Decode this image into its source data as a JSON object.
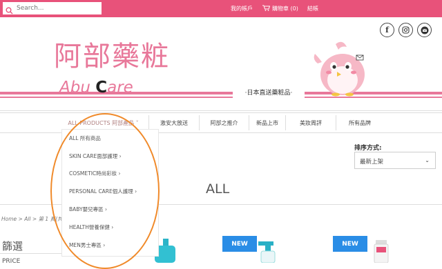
{
  "topbar": {
    "search_placeholder": "Search...",
    "account": "我的帳戶",
    "cart": "購物車 (0)",
    "checkout": "結帳"
  },
  "header": {
    "logo_cn": "阿部藥粧",
    "logo_en_pre": "Abu ",
    "logo_en_c": "C",
    "logo_en_post": "are",
    "tagline": "‧日本直送藥粧品‧"
  },
  "nav": {
    "items": [
      {
        "label": "ALL PRODUCTS 阿部產品 ˅"
      },
      {
        "label": "激安大放送"
      },
      {
        "label": "阿部之推介"
      },
      {
        "label": "新品上市"
      },
      {
        "label": "美妝周評"
      },
      {
        "label": "所有品牌"
      }
    ]
  },
  "dropdown": {
    "items": [
      {
        "label": "ALL 所有商品"
      },
      {
        "label": "SKIN CARE面部護理  ›"
      },
      {
        "label": "COSMETIC時尚彩妝  ›"
      },
      {
        "label": "PERSONAL CARE個人護理  ›"
      },
      {
        "label": "BABY嬰兒專區  ›"
      },
      {
        "label": "HEALTH營養保健  ›"
      },
      {
        "label": "MEN男士專區  ›"
      }
    ]
  },
  "sort": {
    "label": "排序方式:",
    "value": "最新上架"
  },
  "main": {
    "title": "ALL",
    "breadcrumb": "Home > All > 第 1 頁(共",
    "filter_heading": "篩選",
    "price_heading": "PRICE",
    "new_badge": "NEW"
  },
  "colors": {
    "brand_pink": "#e8527a",
    "logo_pink": "#e8789a",
    "new_badge": "#2a8de6",
    "annotation_orange": "#f08a2a"
  }
}
